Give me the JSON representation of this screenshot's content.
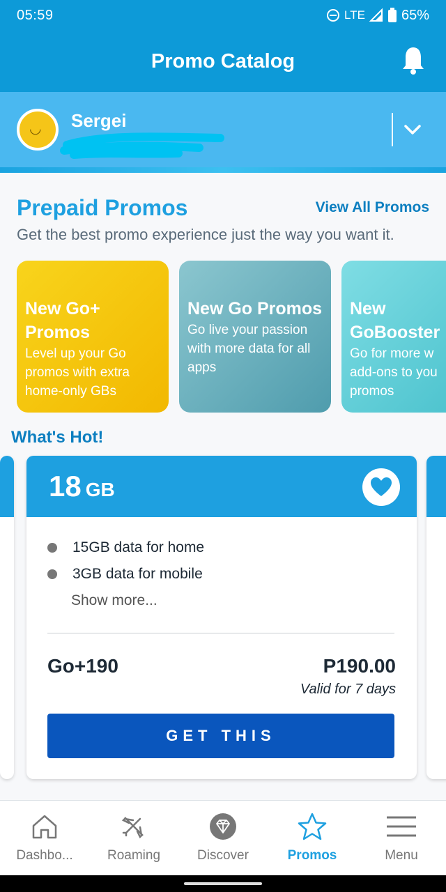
{
  "status_bar": {
    "time": "05:59",
    "network": "LTE",
    "battery": "65%"
  },
  "app_bar": {
    "title": "Promo Catalog"
  },
  "account": {
    "name": "Sergei"
  },
  "prepaid": {
    "title": "Prepaid Promos",
    "view_all": "View All Promos",
    "subtitle": "Get the best promo experience just the way you want it.",
    "cards": [
      {
        "title": "New Go+ Promos",
        "desc": "Level up your Go promos with extra home-only GBs",
        "color": "#f5c518"
      },
      {
        "title": "New Go Promos",
        "desc": "Go live your passion with more data for all apps",
        "color": "#6fb6c4"
      },
      {
        "title": "New GoBooster",
        "desc": "Go for more w add-ons to you promos",
        "color": "#64cfd8"
      }
    ]
  },
  "hot": {
    "title": "What's Hot!",
    "offer": {
      "size": "18",
      "unit": "GB",
      "features": [
        "15GB data for home",
        "3GB data for mobile"
      ],
      "show_more": "Show more...",
      "name": "Go+190",
      "price": "P190.00",
      "validity": "Valid for 7 days",
      "cta": "GET THIS"
    }
  },
  "nav": [
    {
      "label": "Dashbo...",
      "icon": "home-icon"
    },
    {
      "label": "Roaming",
      "icon": "plane-icon"
    },
    {
      "label": "Discover",
      "icon": "diamond-icon"
    },
    {
      "label": "Promos",
      "icon": "star-icon",
      "active": true
    },
    {
      "label": "Menu",
      "icon": "hamburger-icon"
    }
  ]
}
